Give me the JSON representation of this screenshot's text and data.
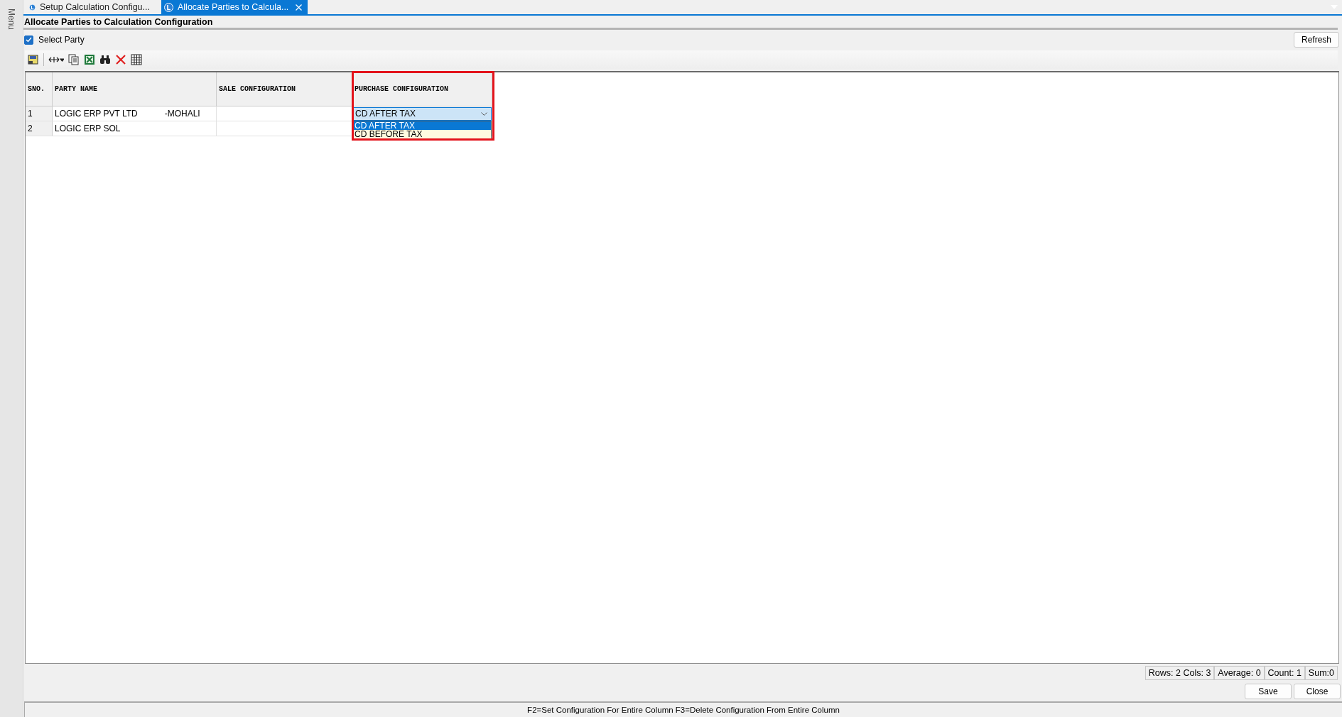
{
  "side_menu": {
    "label": "Menu"
  },
  "tabs": [
    {
      "label": "Setup Calculation Configu...",
      "selected": false
    },
    {
      "label": "Allocate Parties to Calcula...",
      "selected": true
    }
  ],
  "page_title": "Allocate Parties to Calculation Configuration",
  "select_party": {
    "label": "Select Party",
    "checked": true
  },
  "refresh_button": "Refresh",
  "table": {
    "columns": [
      {
        "label": "SNO.",
        "highlighted": false
      },
      {
        "label": "PARTY NAME",
        "highlighted": false
      },
      {
        "label": "SALE CONFIGURATION",
        "highlighted": false
      },
      {
        "label": "PURCHASE CONFIGURATION",
        "highlighted": true
      }
    ],
    "rows": [
      {
        "sno": "1",
        "party_name": "LOGIC ERP PVT LTD",
        "party_place": "-MOHALI",
        "sale_configuration": "",
        "purchase_configuration": "CD AFTER TAX",
        "editing": true
      },
      {
        "sno": "2",
        "party_name": "LOGIC ERP SOL",
        "sale_configuration": "",
        "purchase_configuration": "",
        "editing": false
      }
    ]
  },
  "dropdown_options": [
    {
      "label": "CD AFTER TAX",
      "selected": true
    },
    {
      "label": "CD BEFORE TAX",
      "selected": false
    }
  ],
  "status_cells": [
    "Rows: 2  Cols: 3",
    "Average: 0",
    "Count: 1",
    "Sum:0"
  ],
  "buttons": [
    "Save",
    "Close"
  ],
  "hint_bar": "F2=Set Configuration For Entire Column  F3=Delete Configuration From Entire Column"
}
